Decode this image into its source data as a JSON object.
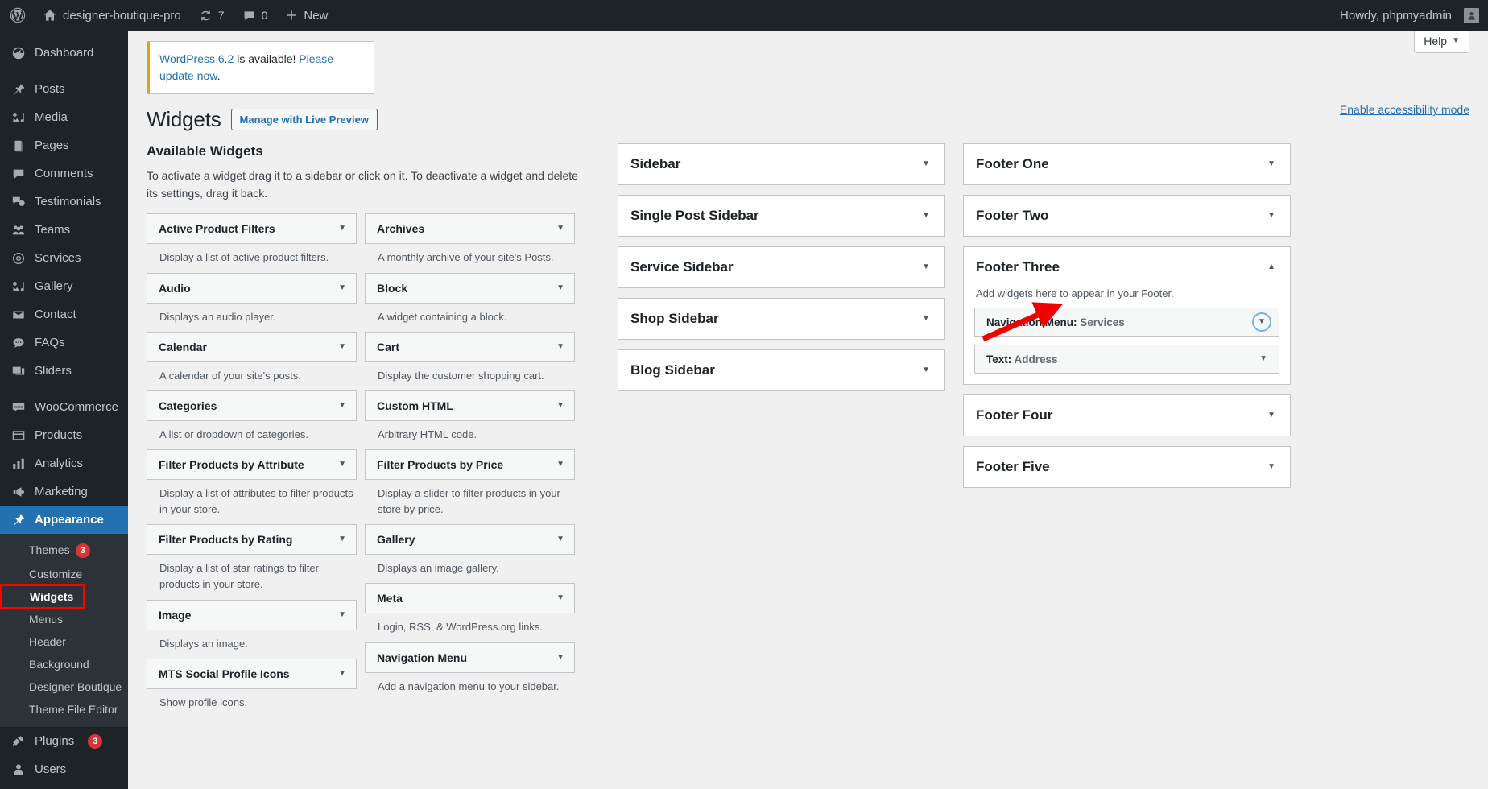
{
  "adminbar": {
    "site_name": "designer-boutique-pro",
    "updates_count": "7",
    "comments_count": "0",
    "new_label": "New",
    "howdy": "Howdy, phpmyadmin"
  },
  "menu": {
    "items": [
      {
        "label": "Dashboard",
        "icon": "dashboard-icon"
      },
      {
        "label": "Posts",
        "icon": "pin-icon"
      },
      {
        "label": "Media",
        "icon": "media-icon"
      },
      {
        "label": "Pages",
        "icon": "pages-icon"
      },
      {
        "label": "Comments",
        "icon": "comments-icon"
      },
      {
        "label": "Testimonials",
        "icon": "testimonials-icon"
      },
      {
        "label": "Teams",
        "icon": "teams-icon"
      },
      {
        "label": "Services",
        "icon": "services-icon"
      },
      {
        "label": "Gallery",
        "icon": "gallery-icon"
      },
      {
        "label": "Contact",
        "icon": "mail-icon"
      },
      {
        "label": "FAQs",
        "icon": "faqs-icon"
      },
      {
        "label": "Sliders",
        "icon": "sliders-icon"
      },
      {
        "label": "WooCommerce",
        "icon": "woocommerce-icon"
      },
      {
        "label": "Products",
        "icon": "products-icon"
      },
      {
        "label": "Analytics",
        "icon": "analytics-icon"
      },
      {
        "label": "Marketing",
        "icon": "marketing-icon"
      },
      {
        "label": "Appearance",
        "icon": "appearance-icon"
      },
      {
        "label": "Plugins",
        "icon": "plugins-icon",
        "badge": "3"
      },
      {
        "label": "Users",
        "icon": "users-icon"
      }
    ],
    "appearance_submenu": [
      {
        "label": "Themes",
        "badge": "3"
      },
      {
        "label": "Customize"
      },
      {
        "label": "Widgets",
        "current": true
      },
      {
        "label": "Menus"
      },
      {
        "label": "Header"
      },
      {
        "label": "Background"
      },
      {
        "label": "Designer Boutique"
      },
      {
        "label": "Theme File Editor"
      }
    ]
  },
  "header": {
    "help_label": "Help",
    "notice_link_1": "WordPress 6.2",
    "notice_mid": " is available! ",
    "notice_link_2": "Please update now",
    "notice_end": ".",
    "accessibility_link": "Enable accessibility mode",
    "page_title": "Widgets",
    "live_preview_button": "Manage with Live Preview"
  },
  "available": {
    "heading": "Available Widgets",
    "intro": "To activate a widget drag it to a sidebar or click on it. To deactivate a widget and delete its settings, drag it back.",
    "left": [
      {
        "name": "Active Product Filters",
        "desc": "Display a list of active product filters."
      },
      {
        "name": "Audio",
        "desc": "Displays an audio player."
      },
      {
        "name": "Calendar",
        "desc": "A calendar of your site's posts."
      },
      {
        "name": "Categories",
        "desc": "A list or dropdown of categories."
      },
      {
        "name": "Filter Products by Attribute",
        "desc": "Display a list of attributes to filter products in your store."
      },
      {
        "name": "Filter Products by Rating",
        "desc": "Display a list of star ratings to filter products in your store."
      },
      {
        "name": "Image",
        "desc": "Displays an image."
      },
      {
        "name": "MTS Social Profile Icons",
        "desc": "Show profile icons."
      }
    ],
    "right": [
      {
        "name": "Archives",
        "desc": "A monthly archive of your site's Posts."
      },
      {
        "name": "Block",
        "desc": "A widget containing a block."
      },
      {
        "name": "Cart",
        "desc": "Display the customer shopping cart."
      },
      {
        "name": "Custom HTML",
        "desc": "Arbitrary HTML code."
      },
      {
        "name": "Filter Products by Price",
        "desc": "Display a slider to filter products in your store by price."
      },
      {
        "name": "Gallery",
        "desc": "Displays an image gallery."
      },
      {
        "name": "Meta",
        "desc": "Login, RSS, & WordPress.org links."
      },
      {
        "name": "Navigation Menu",
        "desc": "Add a navigation menu to your sidebar."
      }
    ]
  },
  "sidebars_mid": [
    {
      "title": "Sidebar"
    },
    {
      "title": "Single Post Sidebar"
    },
    {
      "title": "Service Sidebar"
    },
    {
      "title": "Shop Sidebar"
    },
    {
      "title": "Blog Sidebar"
    }
  ],
  "sidebars_right": [
    {
      "title": "Footer One",
      "expanded": false
    },
    {
      "title": "Footer Two",
      "expanded": false
    },
    {
      "title": "Footer Three",
      "expanded": true,
      "desc": "Add widgets here to appear in your Footer.",
      "widgets": [
        {
          "type": "Navigation Menu",
          "value": "Services",
          "focused": true
        },
        {
          "type": "Text",
          "value": "Address",
          "focused": false
        }
      ]
    },
    {
      "title": "Footer Four",
      "expanded": false
    },
    {
      "title": "Footer Five",
      "expanded": false
    }
  ],
  "colors": {
    "admin_dark": "#1d2327",
    "admin_blue": "#2271b1",
    "link_blue": "#2271b1",
    "notice_amber": "#dba617",
    "badge_red": "#d63638",
    "highlight_red": "#ff0000",
    "focus_ring": "#72aee6"
  }
}
